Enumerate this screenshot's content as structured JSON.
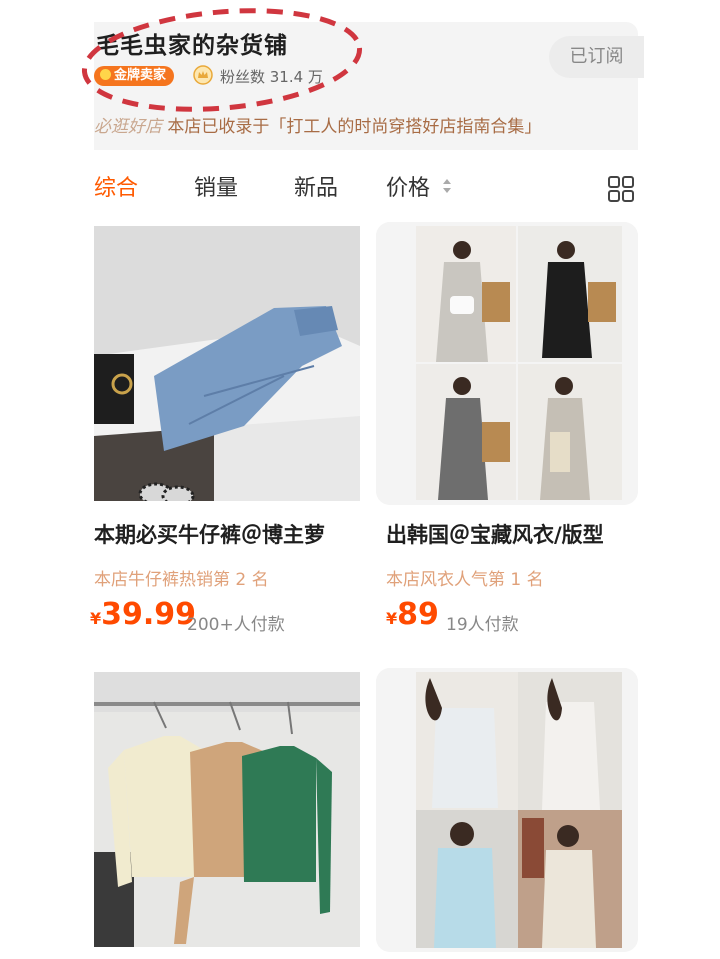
{
  "shop": {
    "name": "毛毛虫家的杂货铺",
    "badge": "金牌卖家",
    "fans": "粉丝数 31.4 万",
    "subscribe_label": "已订阅",
    "promo_tag": "必逛好店",
    "promo_text": "本店已收录于「打工人的时尚穿搭好店指南合集」"
  },
  "tabs": [
    {
      "label": "综合",
      "active": true
    },
    {
      "label": "销量",
      "active": false
    },
    {
      "label": "新品",
      "active": false
    },
    {
      "label": "价格",
      "active": false
    }
  ],
  "products": [
    {
      "title": "本期必买牛仔裤＠博主萝",
      "rank": "本店牛仔裤热销第 2 名",
      "currency": "¥",
      "price": "39.99",
      "sold": "200+人付款"
    },
    {
      "title": "出韩国＠宝藏风衣/版型",
      "rank": "本店风衣人气第 1 名",
      "currency": "¥",
      "price": "89",
      "sold": "19人付款"
    },
    {
      "title": "",
      "rank": "",
      "currency": "",
      "price": "",
      "sold": ""
    },
    {
      "title": "",
      "rank": "",
      "currency": "",
      "price": "",
      "sold": ""
    }
  ],
  "colors": {
    "accent": "#ff5a00",
    "badge": "#f5751e",
    "rank": "#e0a17a",
    "annotation": "#d0363f"
  }
}
